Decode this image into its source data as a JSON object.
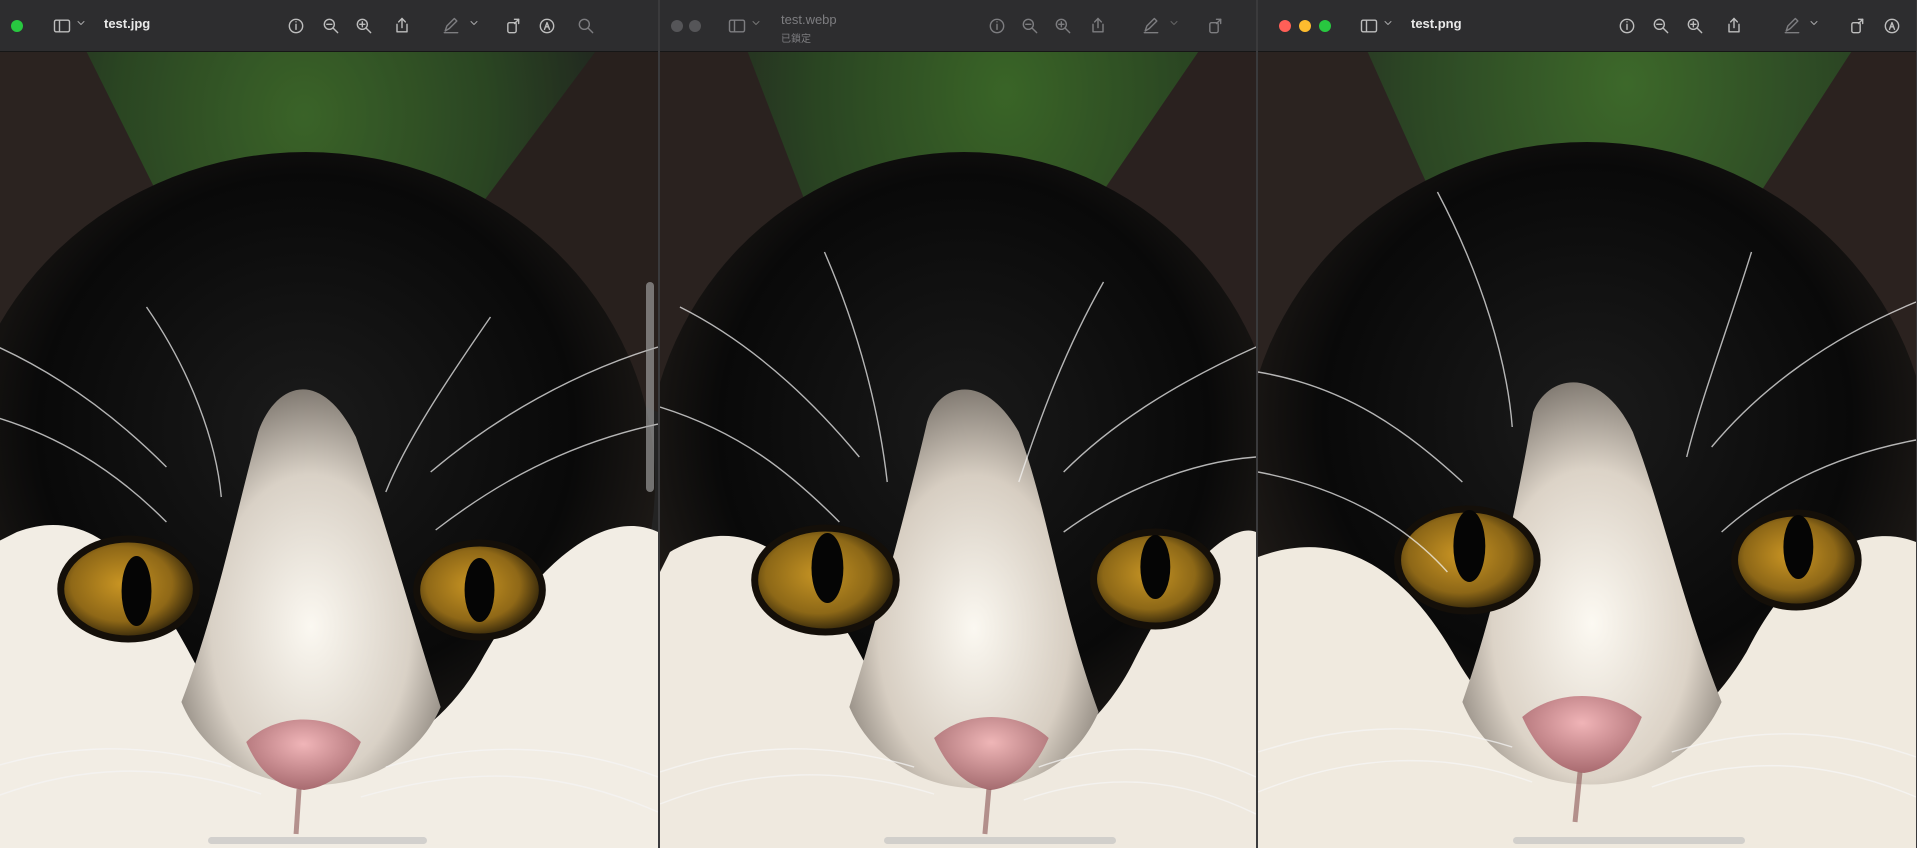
{
  "windows": [
    {
      "title": "test.jpg",
      "subtitle": "",
      "inactive": false,
      "icons": [
        "sidebar-icon",
        "info-icon",
        "zoom-out-icon",
        "zoom-in-icon",
        "share-icon",
        "markup-icon",
        "rotate-icon",
        "annotate-icon",
        "search-icon"
      ]
    },
    {
      "title": "test.webp",
      "subtitle": "已鎖定",
      "inactive": true,
      "icons": [
        "sidebar-icon",
        "info-icon",
        "zoom-out-icon",
        "zoom-in-icon",
        "share-icon",
        "markup-icon",
        "rotate-icon"
      ]
    },
    {
      "title": "test.png",
      "subtitle": "",
      "inactive": false,
      "icons": [
        "sidebar-icon",
        "info-icon",
        "zoom-out-icon",
        "zoom-in-icon",
        "share-icon",
        "markup-icon",
        "rotate-icon",
        "annotate-icon"
      ]
    }
  ],
  "colors": {
    "close": "#ff5f57",
    "minimize": "#febc2e",
    "zoom": "#28c840",
    "inactive_light": "#555558",
    "toolbar": "#2d2d2f"
  },
  "image_description": "close-up of black and white cat face with amber eyes"
}
